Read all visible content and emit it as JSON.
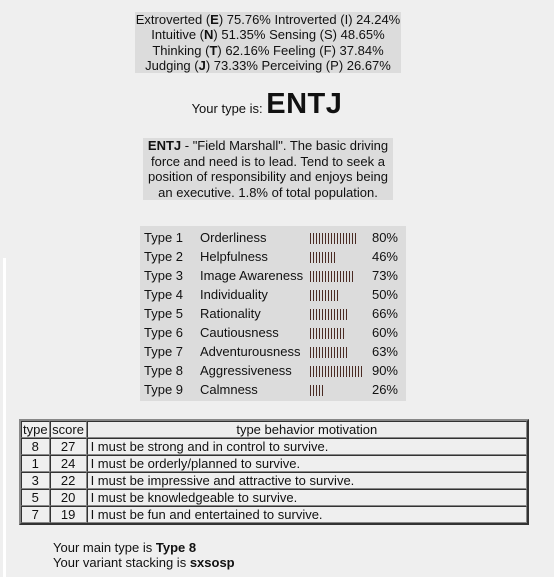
{
  "dichotomies": [
    {
      "left_label": "Extroverted (",
      "left_letter": "E",
      "left_pct": ") 75.76%",
      "right_label": " Introverted (",
      "right_letter": "I",
      "right_pct": ") 24.24%"
    },
    {
      "left_label": "Intuitive (",
      "left_letter": "N",
      "left_pct": ") 51.35%",
      "right_label": " Sensing (",
      "right_letter": "S",
      "right_pct": ") 48.65%"
    },
    {
      "left_label": "Thinking (",
      "left_letter": "T",
      "left_pct": ") 62.16%",
      "right_label": " Feeling (",
      "right_letter": "F",
      "right_pct": ") 37.84%"
    },
    {
      "left_label": "Judging (",
      "left_letter": "J",
      "left_pct": ") 73.33%",
      "right_label": " Perceiving (",
      "right_letter": "P",
      "right_pct": ") 26.67%"
    }
  ],
  "result": {
    "prefix": "Your type is: ",
    "type_code": "ENTJ"
  },
  "description": {
    "code": "ENTJ",
    "text": " - \"Field Marshall\". The basic driving force and need is to lead. Tend to seek a position of responsibility and enjoys being an executive. 1.8% of total population."
  },
  "enneagram": {
    "bar_color": "#4a2a22",
    "rows": [
      {
        "type": "Type 1",
        "name": "Orderliness",
        "percent": 80,
        "pct_label": "80%"
      },
      {
        "type": "Type 2",
        "name": "Helpfulness",
        "percent": 46,
        "pct_label": "46%"
      },
      {
        "type": "Type 3",
        "name": "Image Awareness",
        "percent": 73,
        "pct_label": "73%"
      },
      {
        "type": "Type 4",
        "name": "Individuality",
        "percent": 50,
        "pct_label": "50%"
      },
      {
        "type": "Type 5",
        "name": "Rationality",
        "percent": 66,
        "pct_label": "66%"
      },
      {
        "type": "Type 6",
        "name": "Cautiousness",
        "percent": 60,
        "pct_label": "60%"
      },
      {
        "type": "Type 7",
        "name": "Adventurousness",
        "percent": 63,
        "pct_label": "63%"
      },
      {
        "type": "Type 8",
        "name": "Aggressiveness",
        "percent": 90,
        "pct_label": "90%"
      },
      {
        "type": "Type 9",
        "name": "Calmness",
        "percent": 26,
        "pct_label": "26%"
      }
    ]
  },
  "motivation_table": {
    "headers": {
      "type": "type",
      "score": "score",
      "motivation": "type behavior motivation"
    },
    "rows": [
      {
        "type": "8",
        "score": "27",
        "motivation": "I must be strong and in control to survive."
      },
      {
        "type": "1",
        "score": "24",
        "motivation": "I must be orderly/planned to survive."
      },
      {
        "type": "3",
        "score": "22",
        "motivation": "I must be impressive and attractive to survive."
      },
      {
        "type": "5",
        "score": "20",
        "motivation": "I must be knowledgeable to survive."
      },
      {
        "type": "7",
        "score": "19",
        "motivation": "I must be fun and entertained to survive."
      }
    ]
  },
  "summary": {
    "main_prefix": "Your main type is ",
    "main_value": "Type 8",
    "variant_prefix": "Your variant stacking is ",
    "variant_value": "sxsosp"
  }
}
